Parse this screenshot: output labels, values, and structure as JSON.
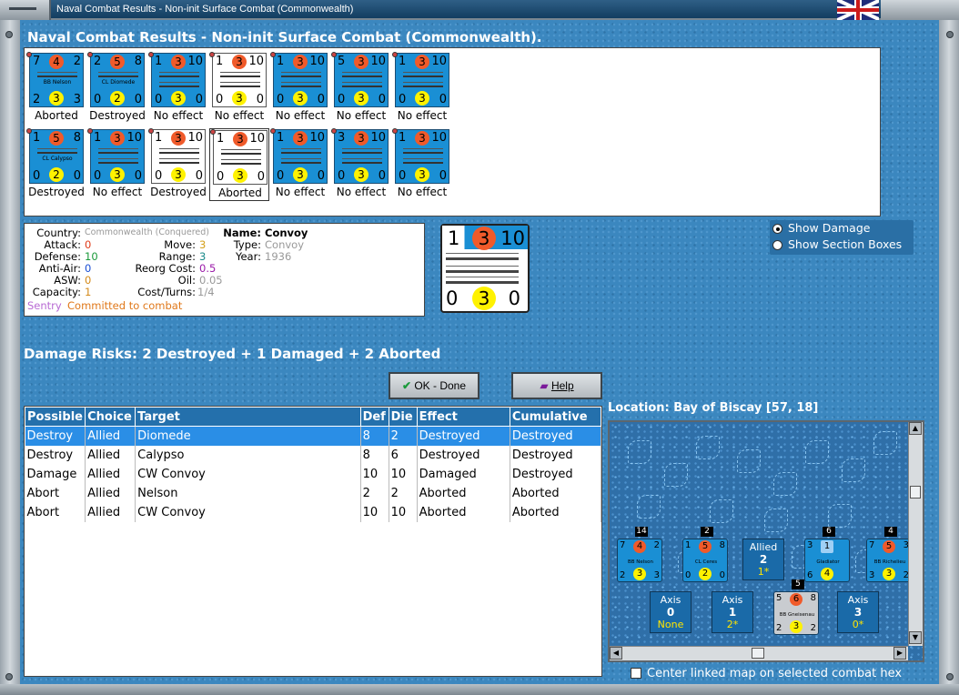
{
  "window": {
    "title": "Naval Combat Results - Non-init Surface Combat (Commonwealth)"
  },
  "heading": "Naval Combat Results - Non-init Surface Combat (Commonwealth).",
  "units_row1": [
    {
      "tl": "7",
      "tc": "4",
      "tr": "2",
      "bl": "2",
      "bc": "3",
      "br": "3",
      "name": "BB Nelson",
      "result": "Aborted",
      "light": false,
      "selected": false
    },
    {
      "tl": "2",
      "tc": "5",
      "tr": "8",
      "bl": "0",
      "bc": "2",
      "br": "0",
      "name": "CL Diomede",
      "result": "Destroyed",
      "light": false,
      "selected": false
    },
    {
      "tl": "1",
      "tc": "3",
      "tr": "10",
      "bl": "0",
      "bc": "3",
      "br": "0",
      "name": "",
      "result": "No effect",
      "light": false,
      "selected": false
    },
    {
      "tl": "1",
      "tc": "3",
      "tr": "10",
      "bl": "0",
      "bc": "3",
      "br": "0",
      "name": "",
      "result": "No effect",
      "light": true,
      "selected": false
    },
    {
      "tl": "1",
      "tc": "3",
      "tr": "10",
      "bl": "0",
      "bc": "3",
      "br": "0",
      "name": "",
      "result": "No effect",
      "light": false,
      "selected": false
    },
    {
      "tl": "5",
      "tc": "3",
      "tr": "10",
      "bl": "0",
      "bc": "3",
      "br": "0",
      "name": "",
      "result": "No effect",
      "light": false,
      "selected": false
    },
    {
      "tl": "1",
      "tc": "3",
      "tr": "10",
      "bl": "0",
      "bc": "3",
      "br": "0",
      "name": "",
      "result": "No effect",
      "light": false,
      "selected": false
    }
  ],
  "units_row2": [
    {
      "tl": "1",
      "tc": "5",
      "tr": "8",
      "bl": "0",
      "bc": "2",
      "br": "0",
      "name": "CL Calypso",
      "result": "Destroyed",
      "light": false,
      "selected": false
    },
    {
      "tl": "1",
      "tc": "3",
      "tr": "10",
      "bl": "0",
      "bc": "3",
      "br": "0",
      "name": "",
      "result": "No effect",
      "light": false,
      "selected": false
    },
    {
      "tl": "1",
      "tc": "3",
      "tr": "10",
      "bl": "0",
      "bc": "3",
      "br": "0",
      "name": "",
      "result": "Destroyed",
      "light": true,
      "selected": false
    },
    {
      "tl": "1",
      "tc": "3",
      "tr": "10",
      "bl": "0",
      "bc": "3",
      "br": "0",
      "name": "",
      "result": "Aborted",
      "light": true,
      "selected": true
    },
    {
      "tl": "1",
      "tc": "3",
      "tr": "10",
      "bl": "0",
      "bc": "3",
      "br": "0",
      "name": "",
      "result": "No effect",
      "light": false,
      "selected": false
    },
    {
      "tl": "3",
      "tc": "3",
      "tr": "10",
      "bl": "0",
      "bc": "3",
      "br": "0",
      "name": "",
      "result": "No effect",
      "light": false,
      "selected": false
    },
    {
      "tl": "1",
      "tc": "3",
      "tr": "10",
      "bl": "0",
      "bc": "3",
      "br": "0",
      "name": "",
      "result": "No effect",
      "light": false,
      "selected": false
    }
  ],
  "info": {
    "country_label": "Country:",
    "country": "Commonwealth (Conquered)",
    "attack_label": "Attack:",
    "attack": "0",
    "defense_label": "Defense:",
    "defense": "10",
    "antiair_label": "Anti-Air:",
    "antiair": "0",
    "asw_label": "ASW:",
    "asw": "0",
    "capacity_label": "Capacity:",
    "capacity": "1",
    "move_label": "Move:",
    "move": "3",
    "range_label": "Range:",
    "range": "3",
    "reorg_label": "Reorg Cost:",
    "reorg": "0.5",
    "oil_label": "Oil:",
    "oil": "0.05",
    "cost_label": "Cost/Turns:",
    "cost": "1/4",
    "name_label": "Name:",
    "name": "Convoy",
    "type_label": "Type:",
    "type": "Convoy",
    "year_label": "Year:",
    "year": "1936",
    "sentry": "Sentry",
    "committed": "Committed to combat"
  },
  "big_counter": {
    "tl": "1",
    "tc": "3",
    "tr": "10",
    "bl": "0",
    "bc": "3",
    "br": "0"
  },
  "radios": {
    "show_damage": "Show Damage",
    "show_section": "Show Section Boxes",
    "selected": "show_damage"
  },
  "risks": "Damage Risks:  2 Destroyed + 1 Damaged + 2 Aborted",
  "buttons": {
    "ok": "OK - Done",
    "help": "Help"
  },
  "table": {
    "headers": [
      "Possible",
      "Choice",
      "Target",
      "Def",
      "Die",
      "Effect",
      "Cumulative"
    ],
    "rows": [
      [
        "Destroy",
        "Allied",
        "Diomede",
        "8",
        "2",
        "Destroyed",
        "Destroyed"
      ],
      [
        "Destroy",
        "Allied",
        "Calypso",
        "8",
        "6",
        "Destroyed",
        "Destroyed"
      ],
      [
        "Damage",
        "Allied",
        "CW Convoy",
        "10",
        "10",
        "Damaged",
        "Destroyed"
      ],
      [
        "Abort",
        "Allied",
        "Nelson",
        "2",
        "2",
        "Aborted",
        "Aborted"
      ],
      [
        "Abort",
        "Allied",
        "CW Convoy",
        "10",
        "10",
        "Aborted",
        "Aborted"
      ]
    ],
    "selected_row": 0
  },
  "location": "Location:  Bay of Biscay [57, 18]",
  "map": {
    "stacks": [
      {
        "count": "14",
        "a": "7",
        "oc": "4",
        "b": "2",
        "c": "2",
        "yc": "3",
        "d": "3",
        "name": "BB Nelson"
      },
      {
        "count": "2",
        "a": "1",
        "oc": "5",
        "b": "8",
        "c": "0",
        "yc": "2",
        "d": "0",
        "name": "CL Ceres"
      },
      {
        "count": "6",
        "a": "3",
        "oc": "1",
        "b": "",
        "c": "6",
        "yc": "4",
        "d": "",
        "name": "Gladiator"
      },
      {
        "count": "4",
        "a": "7",
        "oc": "5",
        "b": "3",
        "c": "3",
        "yc": "3",
        "d": "2",
        "name": "BB Richelieu"
      },
      {
        "count": "5",
        "a": "5",
        "oc": "6",
        "b": "8",
        "c": "2",
        "yc": "3",
        "d": "2",
        "name": "BB Gneisenau"
      }
    ],
    "allied": {
      "label": "Allied",
      "value": "2",
      "sub": "1*"
    },
    "axis": [
      {
        "label": "Axis",
        "value": "0",
        "sub": "None"
      },
      {
        "label": "Axis",
        "value": "1",
        "sub": "2*"
      },
      {
        "label": "Axis",
        "value": "3",
        "sub": "0*"
      }
    ]
  },
  "center_chk": "Center linked map on selected combat hex",
  "colors": {
    "counter_blue": "#1a8fd4",
    "attack_circle": "#f05a2a",
    "defense_circle": "#fff200",
    "header_blue": "#2470ac",
    "selected_row": "#2a8ee6"
  }
}
